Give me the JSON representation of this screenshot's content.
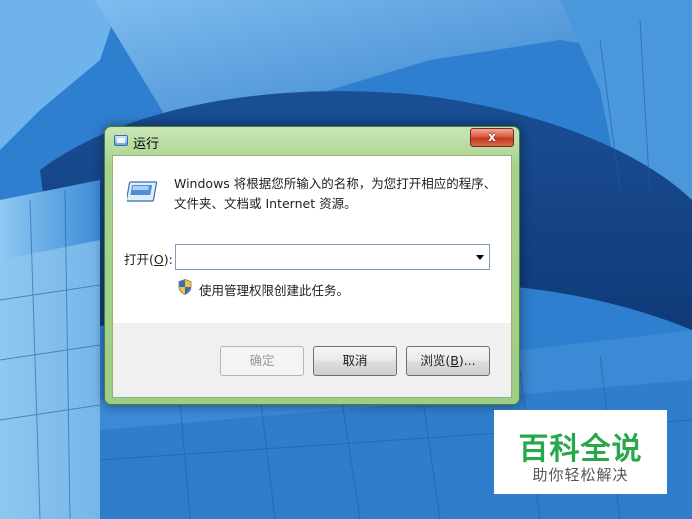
{
  "window": {
    "title": "运行",
    "close_label": "x"
  },
  "dialog": {
    "description_line1": "Windows 将根据您所输入的名称，为您打开相应的程序、",
    "description_line2": "文件夹、文档或 Internet 资源。",
    "open_label_prefix": "打开(",
    "open_label_accel": "O",
    "open_label_suffix": "):",
    "open_value": "",
    "admin_note": "使用管理权限创建此任务。"
  },
  "buttons": {
    "ok": "确定",
    "cancel": "取消",
    "browse_prefix": "浏览(",
    "browse_accel": "B",
    "browse_suffix": ")..."
  },
  "watermark": {
    "title": "百科全说",
    "subtitle": "助你轻松解决"
  },
  "colors": {
    "window_frame": "#a6d38c",
    "close_button": "#c23a1f",
    "watermark_green": "#27a84a"
  },
  "icons": [
    "run-icon",
    "shield-icon",
    "close-icon",
    "dropdown-arrow-icon"
  ]
}
